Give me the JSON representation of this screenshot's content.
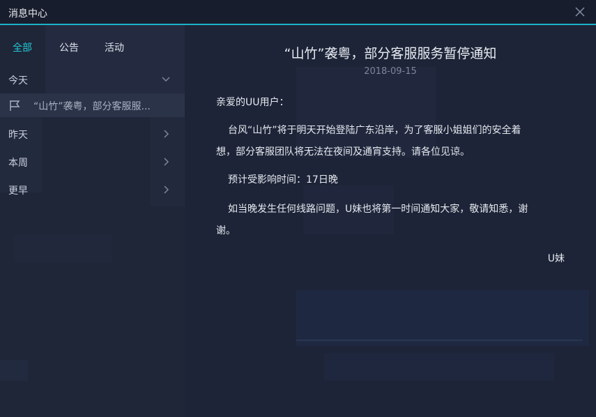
{
  "window": {
    "title": "消息中心"
  },
  "tabs": [
    {
      "label": "全部",
      "active": true
    },
    {
      "label": "公告",
      "active": false
    },
    {
      "label": "活动",
      "active": false
    }
  ],
  "groups": {
    "today": "今天",
    "yesterday": "昨天",
    "this_week": "本周",
    "earlier": "更早"
  },
  "message_list": [
    {
      "title": "“山竹”袭粤，部分客服服...",
      "icon": "flag-icon",
      "selected": true
    }
  ],
  "notice": {
    "title": "“山竹”袭粤，部分客服服务暂停通知",
    "date": "2018-09-15",
    "greeting": "亲爱的UU用户：",
    "p1_line1": "台风“山竹”将于明天开始登陆广东沿岸，为了客服小姐姐们的安全着",
    "p1_line2": "想，部分客服团队将无法在夜间及通宵支持。请各位见谅。",
    "p2": "预计受影响时间：17日晚",
    "p3_line1": "如当晚发生任何线路问题，U妹也将第一时间通知大家，敬请知悉，谢",
    "p3_line2": "谢。",
    "signature": "U妹"
  },
  "colors": {
    "accent": "#22c9d6",
    "titlebar_border": "#19b3c9",
    "selected_row": "#2b3349"
  }
}
